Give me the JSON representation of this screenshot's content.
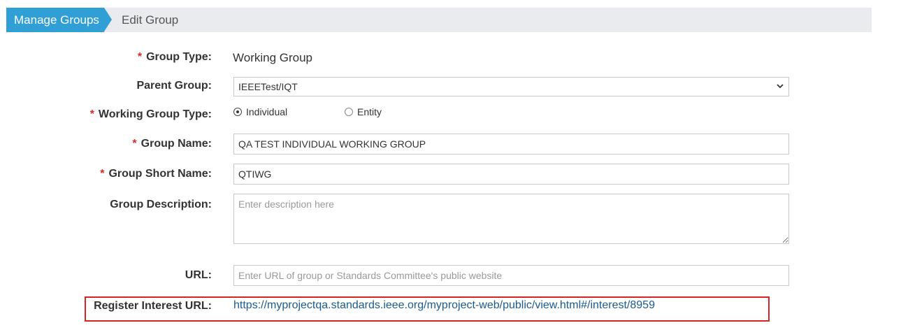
{
  "breadcrumb": {
    "items": [
      {
        "label": "Manage Groups"
      },
      {
        "label": "Edit Group"
      }
    ]
  },
  "form": {
    "required_marker": "*",
    "group_type": {
      "label": "Group Type:",
      "value": "Working Group"
    },
    "parent_group": {
      "label": "Parent Group:",
      "value": "IEEETest/IQT"
    },
    "working_group_type": {
      "label": "Working Group Type:",
      "options": [
        {
          "label": "Individual",
          "selected": true
        },
        {
          "label": "Entity",
          "selected": false
        }
      ]
    },
    "group_name": {
      "label": "Group Name:",
      "value": "QA TEST INDIVIDUAL WORKING GROUP"
    },
    "group_short_name": {
      "label": "Group Short Name:",
      "value": "QTIWG"
    },
    "group_description": {
      "label": "Group Description:",
      "value": "",
      "placeholder": "Enter description here"
    },
    "url": {
      "label": "URL:",
      "value": "",
      "placeholder": "Enter URL of group or Standards Committee's public website"
    },
    "register_interest_url": {
      "label": "Register Interest URL:",
      "value": "https://myprojectqa.standards.ieee.org/myproject-web/public/view.html#/interest/8959"
    }
  },
  "colors": {
    "breadcrumb_active": "#2f9fd5",
    "breadcrumb_bg": "#e9ebee",
    "required": "#d9282d",
    "highlight_border": "#d42424",
    "link": "#1a5c8e"
  }
}
